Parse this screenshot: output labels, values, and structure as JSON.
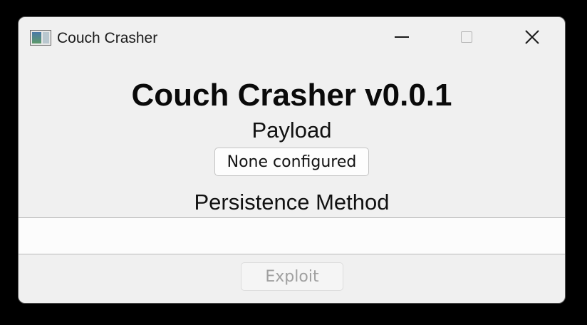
{
  "window": {
    "title": "Couch Crasher",
    "icon": "app-window-icon",
    "controls": {
      "minimize_icon": "minimize-icon",
      "maximize_icon": "maximize-icon",
      "close_icon": "close-icon",
      "close_glyph": "✕"
    }
  },
  "main": {
    "heading": "Couch Crasher v0.0.1",
    "payload_label": "Payload",
    "payload_button_label": "None configured",
    "persistence_label": "Persistence Method",
    "persistence_items": [],
    "exploit_button_label": "Exploit",
    "exploit_enabled": false
  },
  "colors": {
    "window_background": "#f0f0f0",
    "list_background": "#fcfcfc",
    "disabled_text": "#a0a0a0"
  }
}
